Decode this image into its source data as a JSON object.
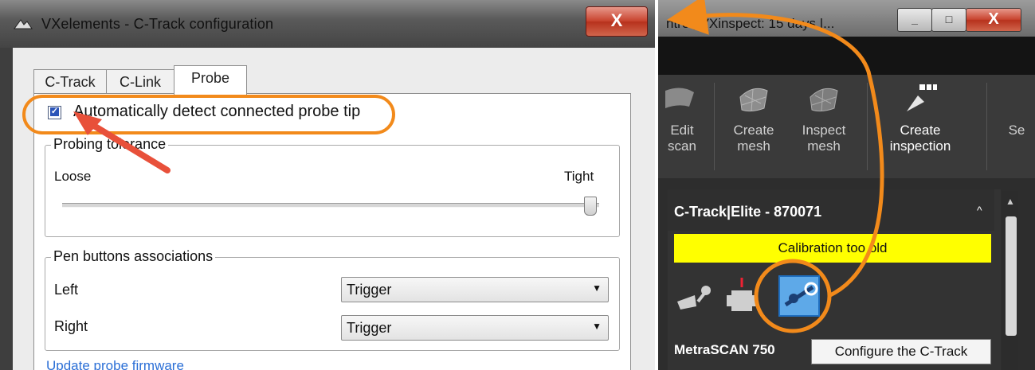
{
  "dialog": {
    "title": "VXelements - C-Track configuration",
    "close_label": "X",
    "tabs": [
      {
        "label": "C-Track",
        "selected": false
      },
      {
        "label": "C-Link",
        "selected": false
      },
      {
        "label": "Probe",
        "selected": true
      }
    ],
    "auto_detect": {
      "label": "Automatically detect connected probe tip",
      "checked": true
    },
    "tolerance": {
      "group_label": "Probing tolerance",
      "min_label": "Loose",
      "max_label": "Tight",
      "value_fraction": 1.0
    },
    "pen_buttons": {
      "group_label": "Pen buttons associations",
      "left_label": "Left",
      "left_value": "Trigger",
      "right_label": "Right",
      "right_value": "Trigger"
    },
    "firmware_link": "Update probe firmware"
  },
  "app": {
    "title": "ntrol, VXinspect: 15 days |...",
    "window_buttons": {
      "minimize": "_",
      "maximize": "□",
      "close": "X"
    },
    "ribbon": [
      {
        "label_line1": "Edit",
        "label_line2": "scan"
      },
      {
        "label_line1": "Create",
        "label_line2": "mesh"
      },
      {
        "label_line1": "Inspect",
        "label_line2": "mesh"
      },
      {
        "label_line1": "Create",
        "label_line2": "inspection"
      },
      {
        "label_line1": "Se",
        "label_line2": ""
      }
    ],
    "device_title": "C-Track|Elite - 870071",
    "collapse_glyph": "^",
    "calibration_status": "Calibration too old",
    "device2": "MetraSCAN 750",
    "tooltip": "Configure the C-Track"
  },
  "colors": {
    "highlight_orange": "#f28a1b",
    "arrow_red": "#e8503a",
    "calibration_yellow": "#ffff00",
    "link_blue": "#2b6fd6"
  }
}
